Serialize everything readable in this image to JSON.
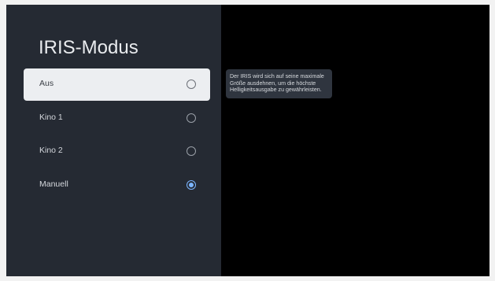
{
  "title": "IRIS-Modus",
  "options": [
    {
      "label": "Aus",
      "selected": false,
      "focused": true
    },
    {
      "label": "Kino 1",
      "selected": false,
      "focused": false
    },
    {
      "label": "Kino 2",
      "selected": false,
      "focused": false
    },
    {
      "label": "Manuell",
      "selected": true,
      "focused": false
    }
  ],
  "description": "Der IRIS wird sich auf seine maximale Größe ausdehnen, um die höchste Helligkeitsausgabe zu gewährleisten.",
  "colors": {
    "panel_bg": "#252a33",
    "focused_bg": "#eceef1",
    "accent": "#7cb5ff",
    "tooltip_bg": "#2f353f"
  },
  "icons": {
    "radio_off": "radio-unchecked-icon",
    "radio_on": "radio-checked-icon"
  }
}
